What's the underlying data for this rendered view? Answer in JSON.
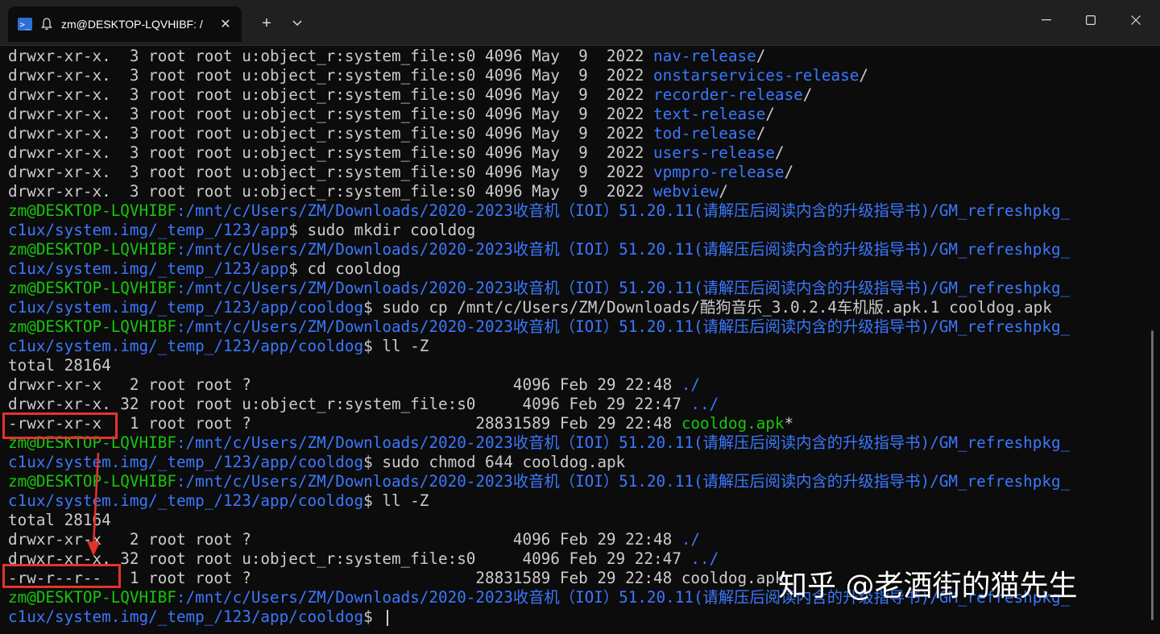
{
  "tab": {
    "title": "zm@DESKTOP-LQVHIBF: /",
    "close_glyph": "✕",
    "new_tab_glyph": "+",
    "icons": {
      "app": "powershell-icon",
      "bell": "bell-icon",
      "dropdown": "chevron-down-icon"
    }
  },
  "window_controls": {
    "minimize": "minimize-icon",
    "maximize": "maximize-icon",
    "close": "close-icon"
  },
  "colors": {
    "prompt_user": "#16c60c",
    "prompt_path": "#3b78ff",
    "text": "#cccccc",
    "background": "#0c0c0c",
    "annotation": "#e5322d"
  },
  "terminal": {
    "lines": [
      {
        "a": "drwxr-xr-x.  3 root root u:object_r:system_file:s0 4096 May  9  2022 ",
        "b": "nav-release",
        "c": "/"
      },
      {
        "a": "drwxr-xr-x.  3 root root u:object_r:system_file:s0 4096 May  9  2022 ",
        "b": "onstarservices-release",
        "c": "/"
      },
      {
        "a": "drwxr-xr-x.  3 root root u:object_r:system_file:s0 4096 May  9  2022 ",
        "b": "recorder-release",
        "c": "/"
      },
      {
        "a": "drwxr-xr-x.  3 root root u:object_r:system_file:s0 4096 May  9  2022 ",
        "b": "text-release",
        "c": "/"
      },
      {
        "a": "drwxr-xr-x.  3 root root u:object_r:system_file:s0 4096 May  9  2022 ",
        "b": "tod-release",
        "c": "/"
      },
      {
        "a": "drwxr-xr-x.  3 root root u:object_r:system_file:s0 4096 May  9  2022 ",
        "b": "users-release",
        "c": "/"
      },
      {
        "a": "drwxr-xr-x.  3 root root u:object_r:system_file:s0 4096 May  9  2022 ",
        "b": "vpmpro-release",
        "c": "/"
      },
      {
        "a": "drwxr-xr-x.  3 root root u:object_r:system_file:s0 4096 May  9  2022 ",
        "b": "webview",
        "c": "/"
      },
      {
        "a": "zm@DESKTOP-LQVHIBF",
        "b": ":/mnt/c/Users/ZM/Downloads/2020-2023收音机（IOI）51.20.11(请解压后阅读内含的升级指导书)/GM_refreshpkg_",
        "c": ""
      },
      {
        "a": "",
        "b": "c1ux/system.img/_temp_/123/app",
        "c": "$ sudo mkdir cooldog"
      },
      {
        "a": "zm@DESKTOP-LQVHIBF",
        "b": ":/mnt/c/Users/ZM/Downloads/2020-2023收音机（IOI）51.20.11(请解压后阅读内含的升级指导书)/GM_refreshpkg_",
        "c": ""
      },
      {
        "a": "",
        "b": "c1ux/system.img/_temp_/123/app",
        "c": "$ cd cooldog"
      },
      {
        "a": "zm@DESKTOP-LQVHIBF",
        "b": ":/mnt/c/Users/ZM/Downloads/2020-2023收音机（IOI）51.20.11(请解压后阅读内含的升级指导书)/GM_refreshpkg_",
        "c": ""
      },
      {
        "a": "",
        "b": "c1ux/system.img/_temp_/123/app/cooldog",
        "c": "$ sudo cp /mnt/c/Users/ZM/Downloads/酷狗音乐_3.0.2.4车机版.apk.1 cooldog.apk"
      },
      {
        "a": "zm@DESKTOP-LQVHIBF",
        "b": ":/mnt/c/Users/ZM/Downloads/2020-2023收音机（IOI）51.20.11(请解压后阅读内含的升级指导书)/GM_refreshpkg_",
        "c": ""
      },
      {
        "a": "",
        "b": "c1ux/system.img/_temp_/123/app/cooldog",
        "c": "$ ll -Z"
      },
      {
        "a": "total 28164",
        "b": "",
        "c": ""
      },
      {
        "a": "drwxr-xr-x   2 root root ?                            4096 Feb 29 22:48 ",
        "b": "./",
        "c": ""
      },
      {
        "a": "drwxr-xr-x. 32 root root u:object_r:system_file:s0     4096 Feb 29 22:47 ",
        "b": "../",
        "c": ""
      },
      {
        "a": "-rwxr-xr-x   1 root root ?                        28831589 Feb 29 22:48 ",
        "b": "cooldog.apk",
        "c": "*"
      },
      {
        "a": "zm@DESKTOP-LQVHIBF",
        "b": ":/mnt/c/Users/ZM/Downloads/2020-2023收音机（IOI）51.20.11(请解压后阅读内含的升级指导书)/GM_refreshpkg_",
        "c": ""
      },
      {
        "a": "",
        "b": "c1ux/system.img/_temp_/123/app/cooldog",
        "c": "$ sudo chmod 644 cooldog.apk"
      },
      {
        "a": "zm@DESKTOP-LQVHIBF",
        "b": ":/mnt/c/Users/ZM/Downloads/2020-2023收音机（IOI）51.20.11(请解压后阅读内含的升级指导书)/GM_refreshpkg_",
        "c": ""
      },
      {
        "a": "",
        "b": "c1ux/system.img/_temp_/123/app/cooldog",
        "c": "$ ll -Z"
      },
      {
        "a": "total 28164",
        "b": "",
        "c": ""
      },
      {
        "a": "drwxr-xr-x   2 root root ?                            4096 Feb 29 22:48 ",
        "b": "./",
        "c": ""
      },
      {
        "a": "drwxr-xr-x. 32 root root u:object_r:system_file:s0     4096 Feb 29 22:47 ",
        "b": "../",
        "c": ""
      },
      {
        "a": "-rw-r--r--   1 root root ?                        28831589 Feb 29 22:48 cooldog.apk",
        "b": "",
        "c": ""
      },
      {
        "a": "zm@DESKTOP-LQVHIBF",
        "b": ":/mnt/c/Users/ZM/Downloads/2020-2023收音机（IOI）51.20.11(请解压后阅读内含的升级指导书)/GM_refreshpkg_",
        "c": ""
      },
      {
        "a": "",
        "b": "c1ux/system.img/_temp_/123/app/cooldog",
        "c": "$ "
      }
    ]
  },
  "watermark": "知乎 @老酒街的猫先生"
}
